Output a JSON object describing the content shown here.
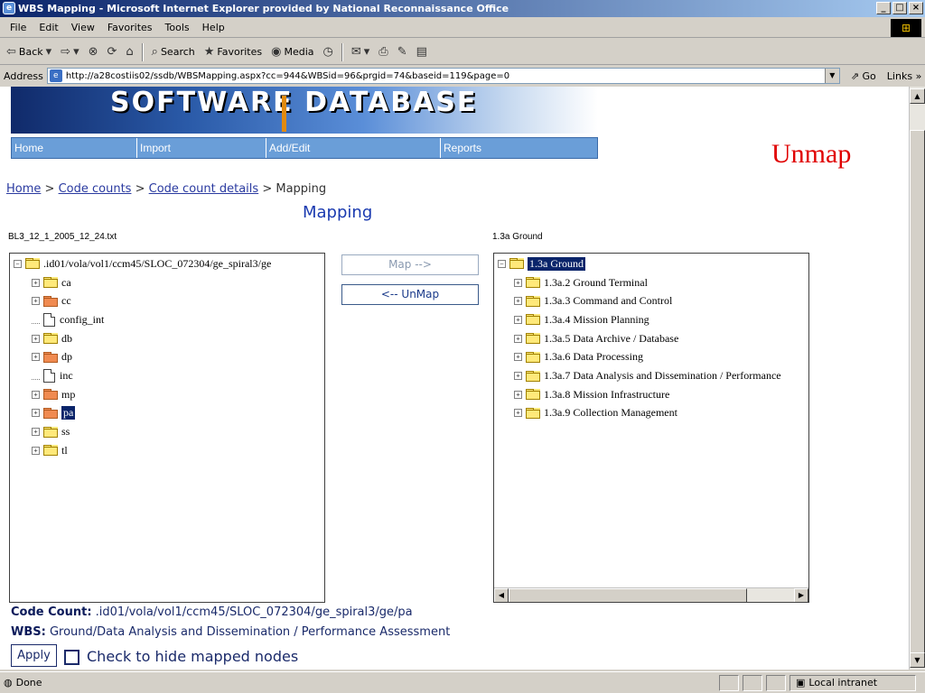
{
  "window": {
    "title": "WBS Mapping - Microsoft Internet Explorer provided by National Reconnaissance Office",
    "buttons": [
      "_",
      "□",
      "×"
    ]
  },
  "menu": [
    "File",
    "Edit",
    "View",
    "Favorites",
    "Tools",
    "Help"
  ],
  "toolbar": {
    "back": "Back",
    "search": "Search",
    "favorites": "Favorites",
    "media": "Media"
  },
  "address": {
    "label": "Address",
    "url": "http://a28costiis02/ssdb/WBSMapping.aspx?cc=944&WBSid=96&prgid=74&baseid=119&page=0",
    "go": "Go",
    "links": "Links"
  },
  "banner": {
    "title": "SOFTWARE DATABASE",
    "nav": [
      "Home",
      "Import",
      "Add/Edit",
      "Reports"
    ]
  },
  "annotation": "Unmap",
  "breadcrumb": {
    "home": "Home",
    "code_counts": "Code counts",
    "code_count_details": "Code count details",
    "current": "Mapping",
    "separator": ">"
  },
  "heading": "Mapping",
  "left_panel": {
    "label": "BL3_12_1_2005_12_24.txt",
    "root": ".id01/vola/vol1/ccm45/SLOC_072304/ge_spiral3/ge",
    "items": [
      {
        "label": "ca",
        "type": "folder",
        "color": "yellow"
      },
      {
        "label": "cc",
        "type": "folder",
        "color": "orange"
      },
      {
        "label": "config_int",
        "type": "file"
      },
      {
        "label": "db",
        "type": "folder",
        "color": "yellow"
      },
      {
        "label": "dp",
        "type": "folder",
        "color": "orange"
      },
      {
        "label": "inc",
        "type": "file"
      },
      {
        "label": "mp",
        "type": "folder",
        "color": "orange"
      },
      {
        "label": "pa",
        "type": "folder",
        "color": "orange",
        "selected": true
      },
      {
        "label": "ss",
        "type": "folder",
        "color": "yellow"
      },
      {
        "label": "tl",
        "type": "folder",
        "color": "yellow"
      }
    ]
  },
  "right_panel": {
    "label": "1.3a Ground",
    "root": "1.3a Ground",
    "items": [
      "1.3a.2 Ground Terminal",
      "1.3a.3 Command and Control",
      "1.3a.4 Mission Planning",
      "1.3a.5 Data Archive / Database",
      "1.3a.6 Data Processing",
      "1.3a.7 Data Analysis and Dissemination / Performance",
      "1.3a.8 Mission Infrastructure",
      "1.3a.9 Collection Management"
    ]
  },
  "buttons": {
    "map": "Map -->",
    "unmap": "<-- UnMap",
    "apply": "Apply"
  },
  "info": {
    "code_count_label": "Code Count:",
    "code_count_value": ".id01/vola/vol1/ccm45/SLOC_072304/ge_spiral3/ge/pa",
    "wbs_label": "WBS:",
    "wbs_value": "Ground/Data Analysis and Dissemination / Performance Assessment"
  },
  "hide_mapped": {
    "label": "Check to hide mapped nodes",
    "checked": false
  },
  "status": {
    "text": "Done",
    "zone": "Local intranet"
  },
  "colors": {
    "accent_red": "#e00000",
    "link_blue": "#2a3aa0",
    "selection": "#0a246a",
    "nav_blue": "#6a9ed8"
  }
}
